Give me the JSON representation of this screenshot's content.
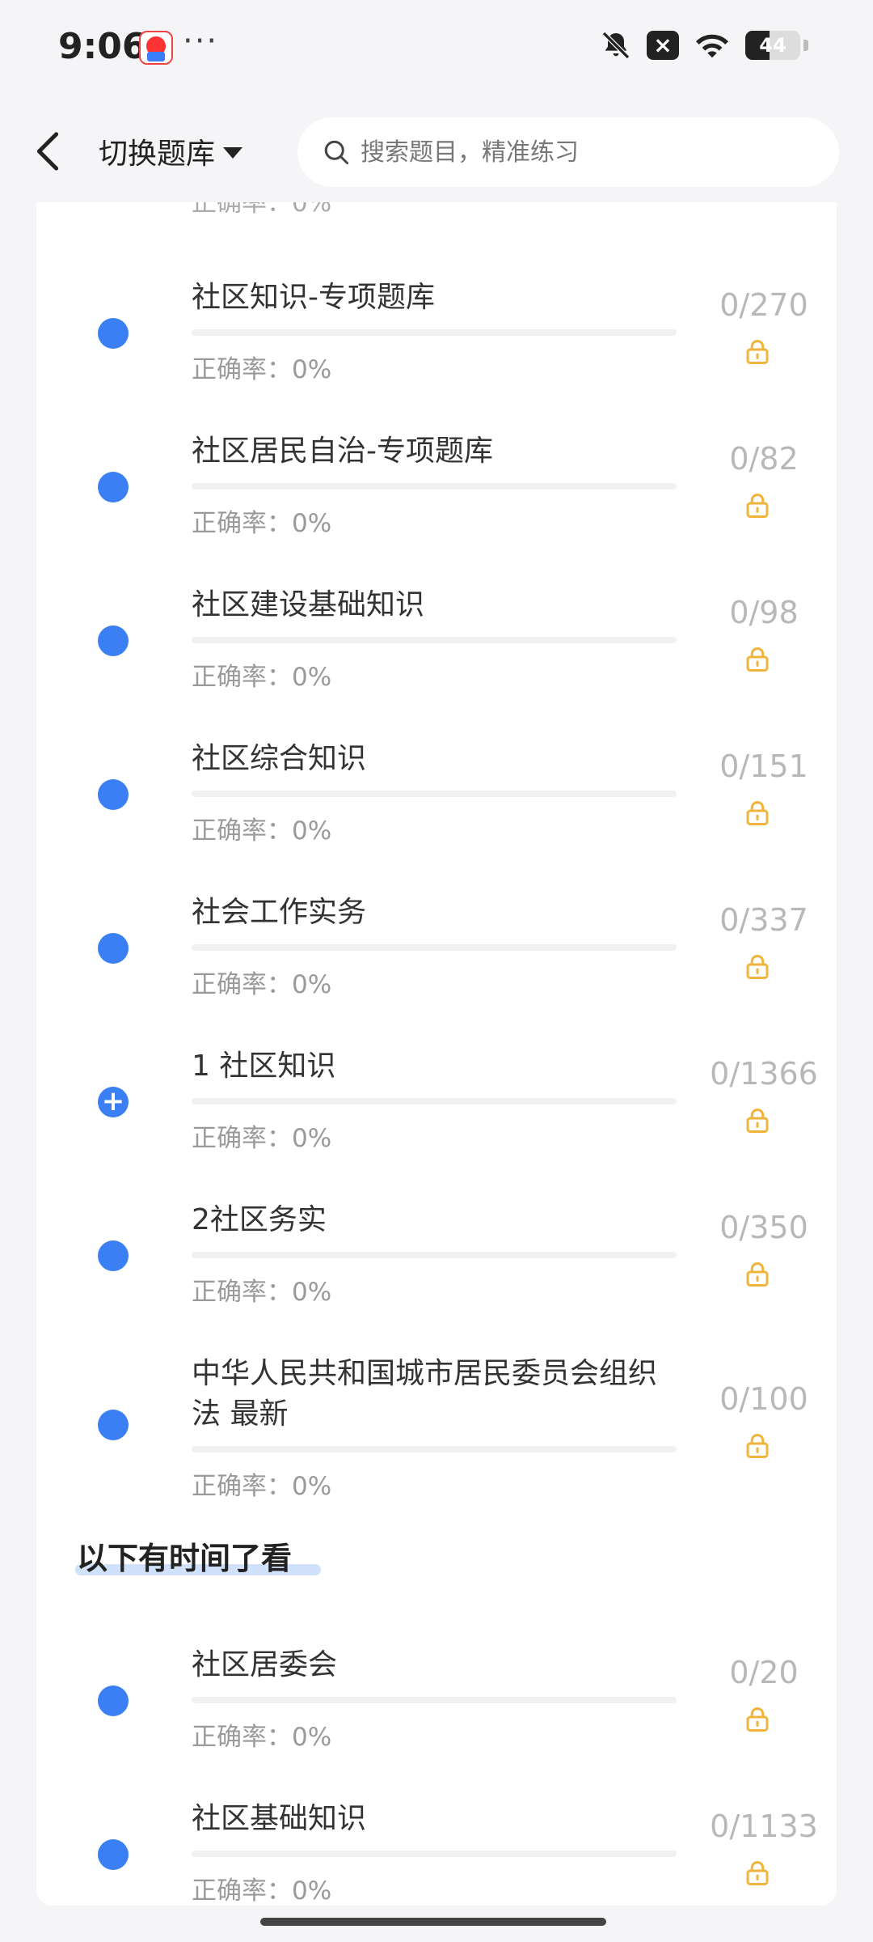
{
  "status": {
    "time": "9:06",
    "battery": "44",
    "battery_level": 0.44
  },
  "header": {
    "switch_label": "切换题库",
    "search_placeholder": "搜索题目，精准练习"
  },
  "partial_top": "正确率：0%",
  "colors": {
    "accent": "#3a7ff3",
    "lock": "#f0b43c",
    "count": "#b8b8b8"
  },
  "items": [
    {
      "title": "社区知识-专项题库",
      "rate": "正确率：0%",
      "count": "0/270",
      "icon": "dot"
    },
    {
      "title": "社区居民自治-专项题库",
      "rate": "正确率：0%",
      "count": "0/82",
      "icon": "dot"
    },
    {
      "title": "社区建设基础知识",
      "rate": "正确率：0%",
      "count": "0/98",
      "icon": "dot"
    },
    {
      "title": "社区综合知识",
      "rate": "正确率：0%",
      "count": "0/151",
      "icon": "dot"
    },
    {
      "title": "社会工作实务",
      "rate": "正确率：0%",
      "count": "0/337",
      "icon": "dot"
    },
    {
      "title": "1 社区知识",
      "rate": "正确率：0%",
      "count": "0/1366",
      "icon": "plus"
    },
    {
      "title": "2社区务实",
      "rate": "正确率：0%",
      "count": "0/350",
      "icon": "dot"
    },
    {
      "title": "中华人民共和国城市居民委员会组织法 最新",
      "rate": "正确率：0%",
      "count": "0/100",
      "icon": "dot"
    }
  ],
  "section": {
    "title": "以下有时间了看"
  },
  "items2": [
    {
      "title": "社区居委会",
      "rate": "正确率：0%",
      "count": "0/20",
      "icon": "dot"
    },
    {
      "title": "社区基础知识",
      "rate": "正确率：0%",
      "count": "0/1133",
      "icon": "dot"
    }
  ]
}
